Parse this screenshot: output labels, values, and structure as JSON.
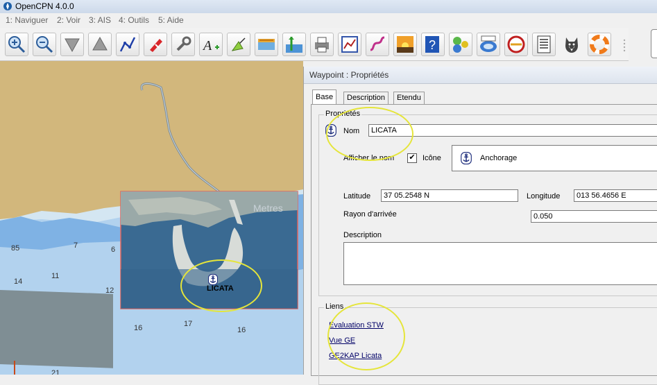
{
  "window": {
    "title": "OpenCPN 4.0.0"
  },
  "menu": [
    "1: Naviguer",
    "2: Voir",
    "3: AIS",
    "4: Outils",
    "5: Aide"
  ],
  "toolbar": [
    "zoom-in-icon",
    "zoom-out-icon",
    "scale-down-icon",
    "scale-up-icon",
    "route-icon",
    "ship-icon",
    "settings-icon",
    "text-icon",
    "track-icon",
    "chart-quilt-icon",
    "tide-icon",
    "print-icon",
    "route-manager-icon",
    "track-manager-icon",
    "sunset-icon",
    "help-icon",
    "tools-icon",
    "ge2kap-icon",
    "weather-icon",
    "text-doc-icon",
    "dog-icon",
    "lifebuoy-icon"
  ],
  "chart": {
    "soundings": [
      "85",
      "7",
      "6",
      "14",
      "11",
      "12",
      "16",
      "17",
      "16",
      "21"
    ],
    "waypoint_label": "LICATA",
    "overlay_text": "Metres",
    "colors": {
      "land": "#d2b77c",
      "shallow": "#7fb2e4",
      "medium": "#b2d2ee",
      "deep": "#d4e6f2",
      "overlay": "#3a6a92",
      "overlay_border": "#e0645c",
      "grey_zone": "#7f8e94"
    }
  },
  "dialog": {
    "title": "Waypoint : Propriétés",
    "tabs": [
      "Base",
      "Description",
      "Etendu"
    ],
    "properties_group": "Propriétés",
    "name_label": "Nom",
    "name_value": "LICATA",
    "show_name_label": "Afficher le nom",
    "show_name_checked": true,
    "icon_label": "Icône",
    "icon_value": "Anchorage",
    "latitude_label": "Latitude",
    "latitude_value": "37 05.2548 N",
    "longitude_label": "Longitude",
    "longitude_value": "013 56.4656 E",
    "radius_label": "Rayon d'arrivée",
    "radius_value": "0.050",
    "description_label": "Description",
    "description_value": "",
    "links_group": "Liens",
    "links": [
      "Evaluation STW",
      "Vue GE",
      "GE2KAP Licata"
    ]
  }
}
